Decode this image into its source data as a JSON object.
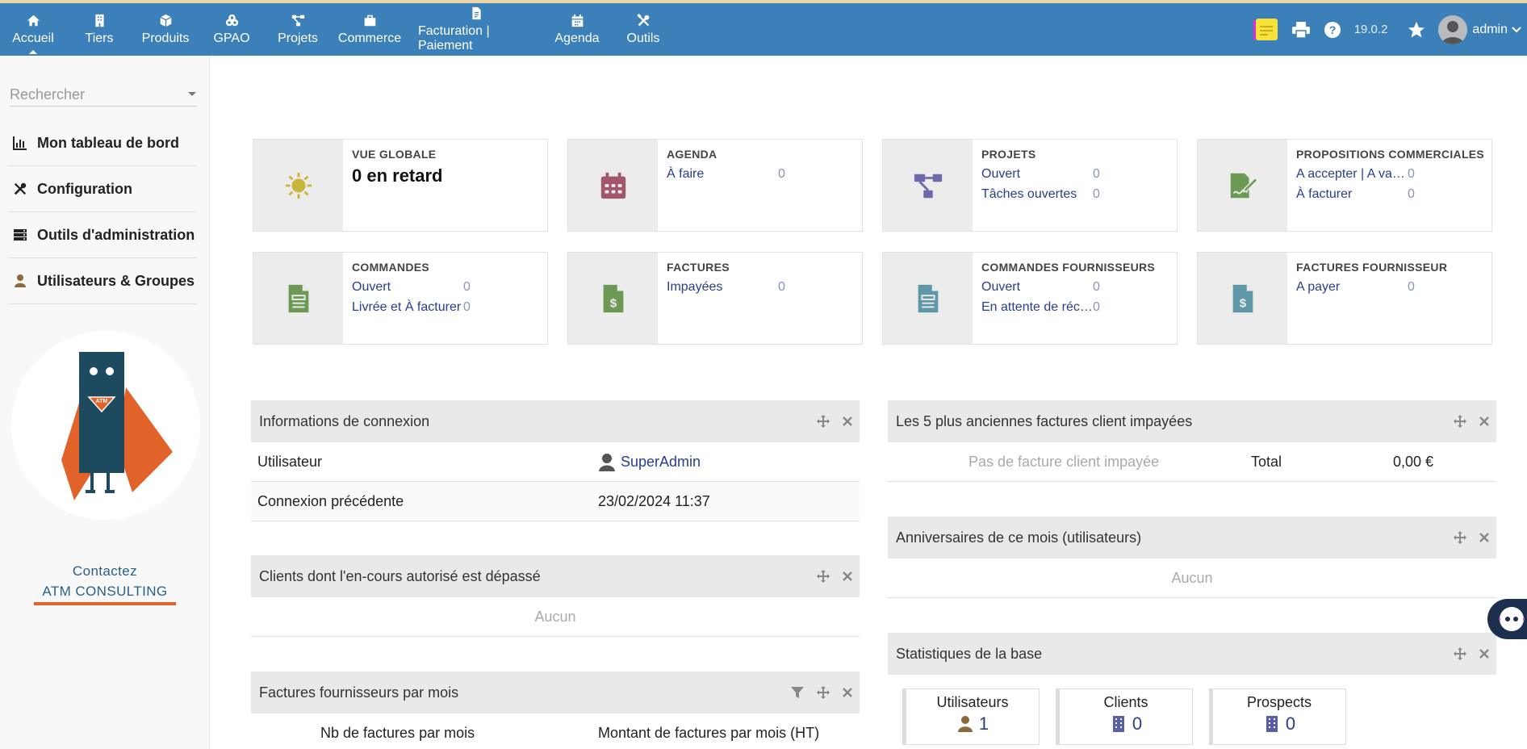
{
  "topbar": {
    "menu": [
      {
        "label": "Accueil",
        "icon": "home-icon",
        "active": true
      },
      {
        "label": "Tiers",
        "icon": "building-icon"
      },
      {
        "label": "Produits",
        "icon": "cube-icon"
      },
      {
        "label": "GPAO",
        "icon": "cubes-icon"
      },
      {
        "label": "Projets",
        "icon": "project-icon"
      },
      {
        "label": "Commerce",
        "icon": "briefcase-icon"
      },
      {
        "label": "Facturation | Paiement",
        "icon": "invoice-icon"
      },
      {
        "label": "Agenda",
        "icon": "calendar-icon"
      },
      {
        "label": "Outils",
        "icon": "tools-icon"
      }
    ],
    "version": "19.0.2",
    "user": "admin"
  },
  "sidebar": {
    "search_placeholder": "Rechercher",
    "items": [
      {
        "label": "Mon tableau de bord",
        "icon": "chart-icon"
      },
      {
        "label": "Configuration",
        "icon": "tools-icon"
      },
      {
        "label": "Outils d'administration",
        "icon": "server-icon"
      },
      {
        "label": "Utilisateurs & Groupes",
        "icon": "user-icon"
      }
    ],
    "contact_line1": "Contactez",
    "contact_line2": "ATM CONSULTING",
    "mascot_text": "ATM"
  },
  "boxes": [
    {
      "title": "VUE GLOBALE",
      "big": "0 en retard",
      "icon": "sun-icon",
      "color": "#c8b53c",
      "rows": []
    },
    {
      "title": "AGENDA",
      "icon": "calendar-icon",
      "color": "#a2566c",
      "rows": [
        {
          "label": "À faire",
          "value": "0"
        }
      ]
    },
    {
      "title": "PROJETS",
      "icon": "project-icon",
      "color": "#6c6aa8",
      "rows": [
        {
          "label": "Ouvert",
          "value": "0"
        },
        {
          "label": "Tâches ouvertes",
          "value": "0"
        }
      ]
    },
    {
      "title": "PROPOSITIONS COMMERCIALES",
      "icon": "signature-icon",
      "color": "#6c9a54",
      "rows": [
        {
          "label": "A accepter | A valider",
          "value": "0"
        },
        {
          "label": "À facturer",
          "value": "0"
        }
      ]
    },
    {
      "title": "COMMANDES",
      "icon": "order-icon",
      "color": "#6c9a54",
      "rows": [
        {
          "label": "Ouvert",
          "value": "0"
        },
        {
          "label": "Livrée et À facturer",
          "value": "0"
        }
      ]
    },
    {
      "title": "FACTURES",
      "icon": "invoice-dollar-icon",
      "color": "#6c9a54",
      "rows": [
        {
          "label": "Impayées",
          "value": "0"
        }
      ]
    },
    {
      "title": "COMMANDES FOURNISSEURS",
      "icon": "order-icon",
      "color": "#5f96a8",
      "rows": [
        {
          "label": "Ouvert",
          "value": "0"
        },
        {
          "label": "En attente de réception",
          "value": "0"
        }
      ]
    },
    {
      "title": "FACTURES FOURNISSEUR",
      "icon": "invoice-dollar-icon",
      "color": "#5f96a8",
      "rows": [
        {
          "label": "A payer",
          "value": "0"
        }
      ]
    }
  ],
  "panels": {
    "login_info": {
      "title": "Informations de connexion",
      "rows": [
        {
          "label": "Utilisateur",
          "value": "SuperAdmin"
        },
        {
          "label": "Connexion précédente",
          "value": "23/02/2024 11:37"
        }
      ]
    },
    "clients_over": {
      "title": "Clients dont l'en-cours autorisé est dépassé",
      "empty": "Aucun"
    },
    "supplier_invoices": {
      "title": "Factures fournisseurs par mois",
      "col1": "Nb de factures par mois",
      "col2": "Montant de factures par mois (HT)"
    },
    "oldest_unpaid": {
      "title": "Les 5 plus anciennes factures client impayées",
      "empty": "Pas de facture client impayée",
      "total_label": "Total",
      "total_value": "0,00 €"
    },
    "birthdays": {
      "title": "Anniversaires de ce mois (utilisateurs)",
      "empty": "Aucun"
    },
    "stats": {
      "title": "Statistiques de la base",
      "cards": [
        {
          "label": "Utilisateurs",
          "value": "1",
          "icon": "user-icon",
          "color": "#8a6a3c"
        },
        {
          "label": "Clients",
          "value": "0",
          "icon": "building-icon",
          "color": "#5a5fa8"
        },
        {
          "label": "Prospects",
          "value": "0",
          "icon": "building-icon",
          "color": "#5a5fa8"
        }
      ]
    }
  }
}
